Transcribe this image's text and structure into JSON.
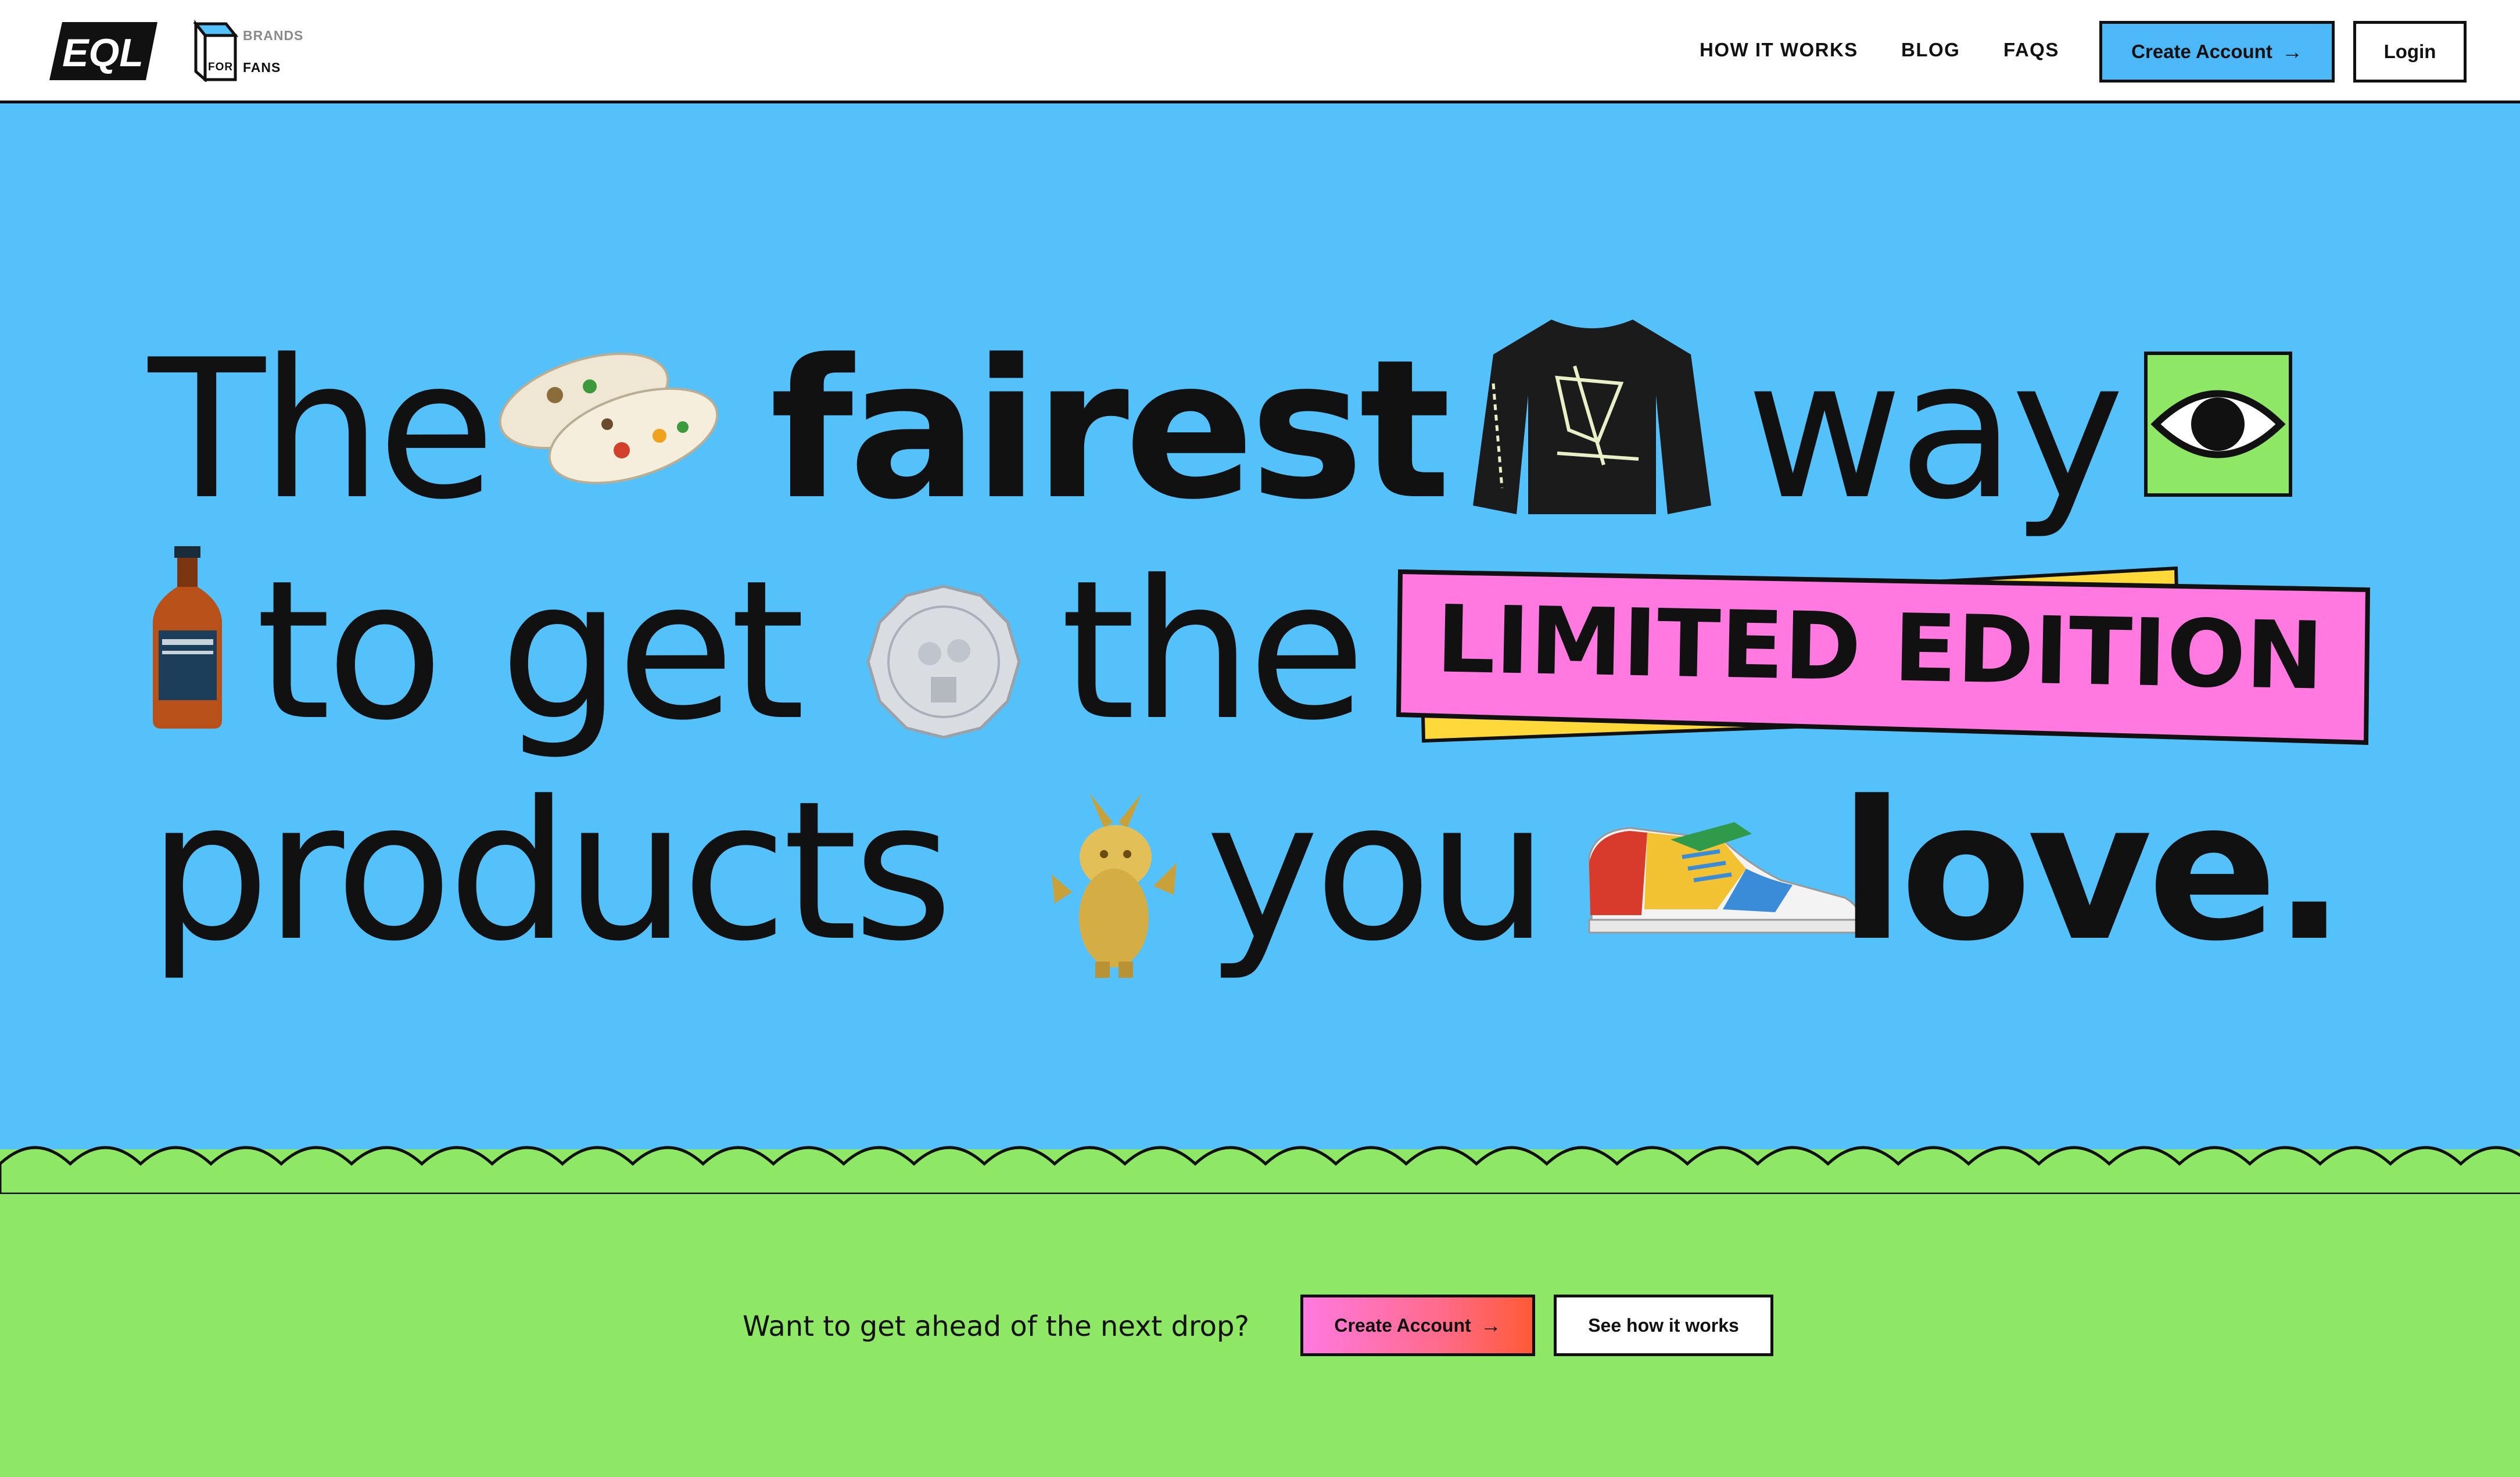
{
  "header": {
    "logo_text": "EQL",
    "tagline": {
      "top": "BRANDS",
      "for": "FOR",
      "bottom": "FANS"
    },
    "nav": [
      "HOW IT WORKS",
      "BLOG",
      "FAQS"
    ],
    "create_account": "Create Account",
    "login": "Login"
  },
  "hero": {
    "words": {
      "the1": "The",
      "fairest": "fairest",
      "way": "way",
      "to": "to",
      "get": "get",
      "the2": "the",
      "limited": "LIMITED EDITION",
      "products": "products",
      "you": "you",
      "love": "love."
    }
  },
  "cta": {
    "question": "Want to get ahead of the next drop?",
    "create_account": "Create Account",
    "see_how": "See how it works"
  },
  "colors": {
    "hero_bg": "#55c1fb",
    "footer_bg": "#8ee765",
    "pink": "#ff79e0",
    "yellow": "#ffd93a",
    "eye_bg": "#8ee765",
    "create_btn": "#4db8f8"
  },
  "icons": [
    "clogs-icon",
    "sweater-icon",
    "eye-icon",
    "whisky-bottle-icon",
    "coin-icon",
    "gold-pikachu-icon",
    "sneaker-icon",
    "arrow-right-icon"
  ]
}
